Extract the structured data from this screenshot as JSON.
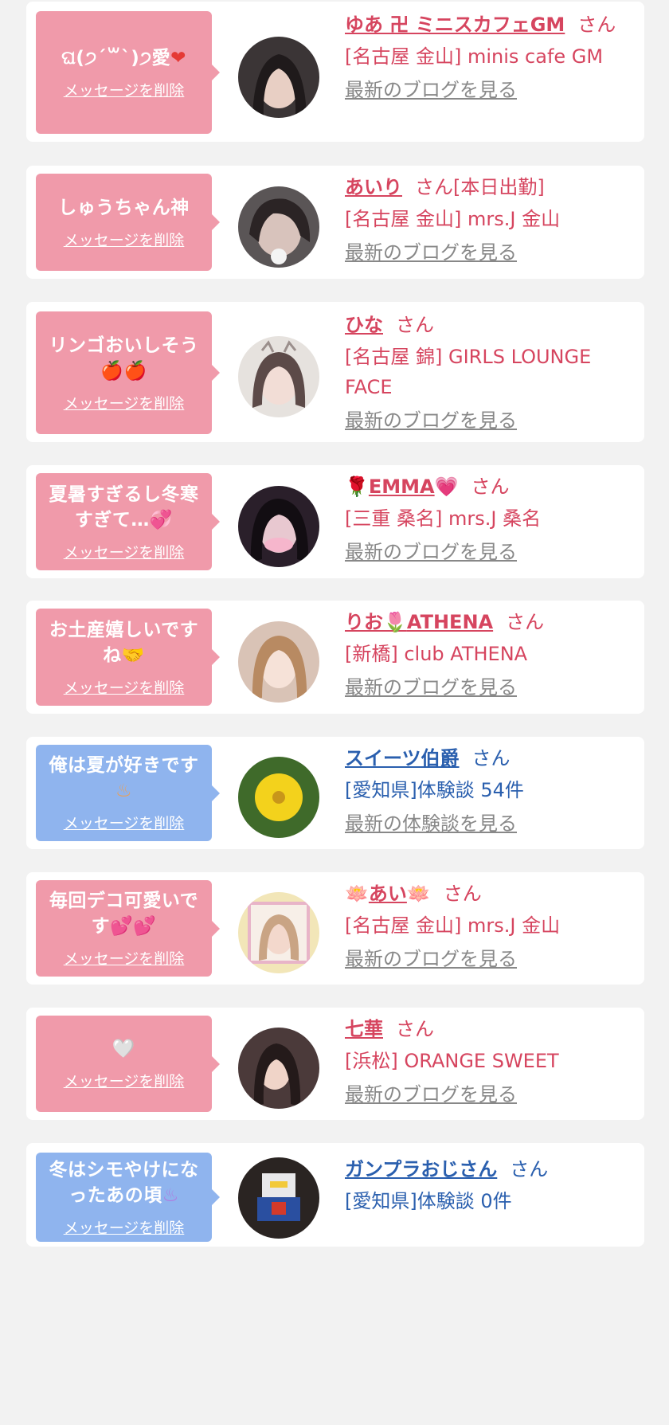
{
  "items": [
    {
      "bubble_text": "ଘ(੭ˊ꒳ˋ)੭愛",
      "bubble_emoji": "❤",
      "delete_label": "メッセージを削除",
      "name": "ゆあ 卍 ミニスカフェGM",
      "san": "さん",
      "shop": "[名古屋 金山] minis cafe GM",
      "link": "最新のブログを見る",
      "type": "pink"
    },
    {
      "bubble_text": "しゅうちゃん神",
      "bubble_emoji": "",
      "delete_label": "メッセージを削除",
      "name": "あいり",
      "san": "さん[本日出勤]",
      "shop": "[名古屋 金山] mrs.J 金山",
      "link": "最新のブログを見る",
      "type": "pink"
    },
    {
      "bubble_text": "リンゴおいしそう",
      "bubble_emoji": "🍎🍎",
      "delete_label": "メッセージを削除",
      "name": "ひな",
      "san": "さん",
      "shop": "[名古屋 錦] GIRLS LOUNGE FACE",
      "link": "最新のブログを見る",
      "type": "pink"
    },
    {
      "bubble_text": "夏暑すぎるし冬寒すぎて…",
      "bubble_emoji": "💞",
      "delete_label": "メッセージを削除",
      "name": "EMMA",
      "name_prefix_emoji": "🌹",
      "name_suffix_emoji": "💗",
      "san": "さん",
      "shop": "[三重 桑名] mrs.J 桑名",
      "link": "最新のブログを見る",
      "type": "pink"
    },
    {
      "bubble_text": "お土産嬉しいですね",
      "bubble_emoji": "🤝",
      "delete_label": "メッセージを削除",
      "name": "りお",
      "name_mid_emoji": "🌷",
      "name_suffix": "ATHENA",
      "san": "さん",
      "shop": "[新橋] club ATHENA",
      "link": "最新のブログを見る",
      "type": "pink"
    },
    {
      "bubble_text": "俺は夏が好きです",
      "bubble_emoji": "♨",
      "delete_label": "メッセージを削除",
      "name": "スイーツ伯爵",
      "san": "さん",
      "shop": "[愛知県]体験談 54件",
      "link": "最新の体験談を見る",
      "type": "blue"
    },
    {
      "bubble_text": "毎回デコ可愛いです",
      "bubble_emoji": "💕💕",
      "delete_label": "メッセージを削除",
      "name": "あい",
      "name_prefix_emoji": "🪷",
      "name_suffix_emoji": "🪷",
      "san": "さん",
      "shop": "[名古屋 金山] mrs.J 金山",
      "link": "最新のブログを見る",
      "type": "pink"
    },
    {
      "bubble_text": "",
      "bubble_emoji": "🤍",
      "delete_label": "メッセージを削除",
      "name": "七華",
      "san": "さん",
      "shop": "[浜松] ORANGE SWEET",
      "link": "最新のブログを見る",
      "type": "pink"
    },
    {
      "bubble_text": "冬はシモやけになったあの頃",
      "bubble_emoji": "♨",
      "delete_label": "メッセージを削除",
      "name": "ガンプラおじさん",
      "san": "さん",
      "shop": "[愛知県]体験談 0件",
      "link": "",
      "type": "blue"
    }
  ]
}
